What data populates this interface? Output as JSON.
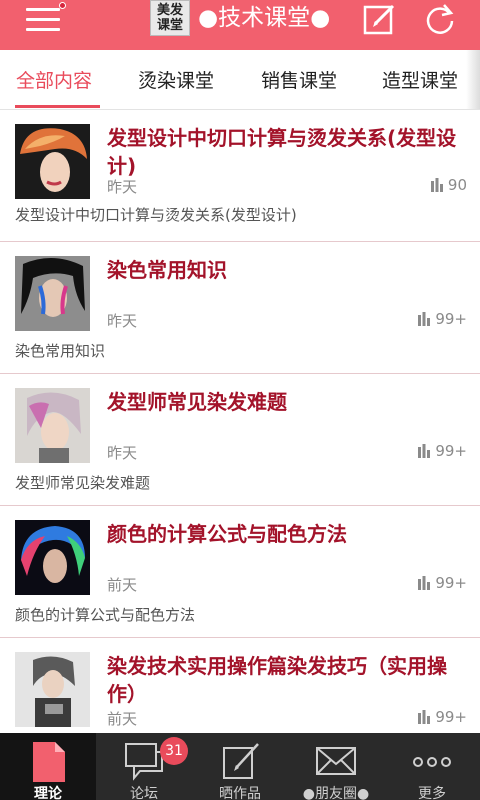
{
  "header": {
    "logo_line1": "美发",
    "logo_line2": "课堂",
    "title": "●技术课堂●"
  },
  "tabs": [
    {
      "label": "全部内容",
      "active": true
    },
    {
      "label": "烫染课堂",
      "active": false
    },
    {
      "label": "销售课堂",
      "active": false
    },
    {
      "label": "造型课堂",
      "active": false
    }
  ],
  "articles": [
    {
      "title": "发型设计中切口计算与烫发关系(发型设计)",
      "time": "昨天",
      "views": "90",
      "description": "发型设计中切口计算与烫发关系(发型设计)"
    },
    {
      "title": "染色常用知识",
      "time": "昨天",
      "views": "99+",
      "description": "染色常用知识"
    },
    {
      "title": "发型师常见染发难题",
      "time": "昨天",
      "views": "99+",
      "description": "发型师常见染发难题"
    },
    {
      "title": "颜色的计算公式与配色方法",
      "time": "前天",
      "views": "99+",
      "description": "颜色的计算公式与配色方法"
    },
    {
      "title": "染发技术实用操作篇染发技巧（实用操作）",
      "time": "前天",
      "views": "99+",
      "description": ""
    }
  ],
  "bottom_nav": [
    {
      "label": "理论",
      "icon": "document-icon",
      "active": true
    },
    {
      "label": "论坛",
      "icon": "chat-bubbles-icon",
      "badge": "31"
    },
    {
      "label": "晒作品",
      "icon": "edit-icon"
    },
    {
      "label": "●朋友圈●",
      "icon": "envelope-icon"
    },
    {
      "label": "更多",
      "icon": "more-icon"
    }
  ],
  "colors": {
    "header_bg": "#f2606e",
    "accent": "#e94b5b",
    "title_text": "#a3132a",
    "nav_bg": "#2a2a2a"
  }
}
